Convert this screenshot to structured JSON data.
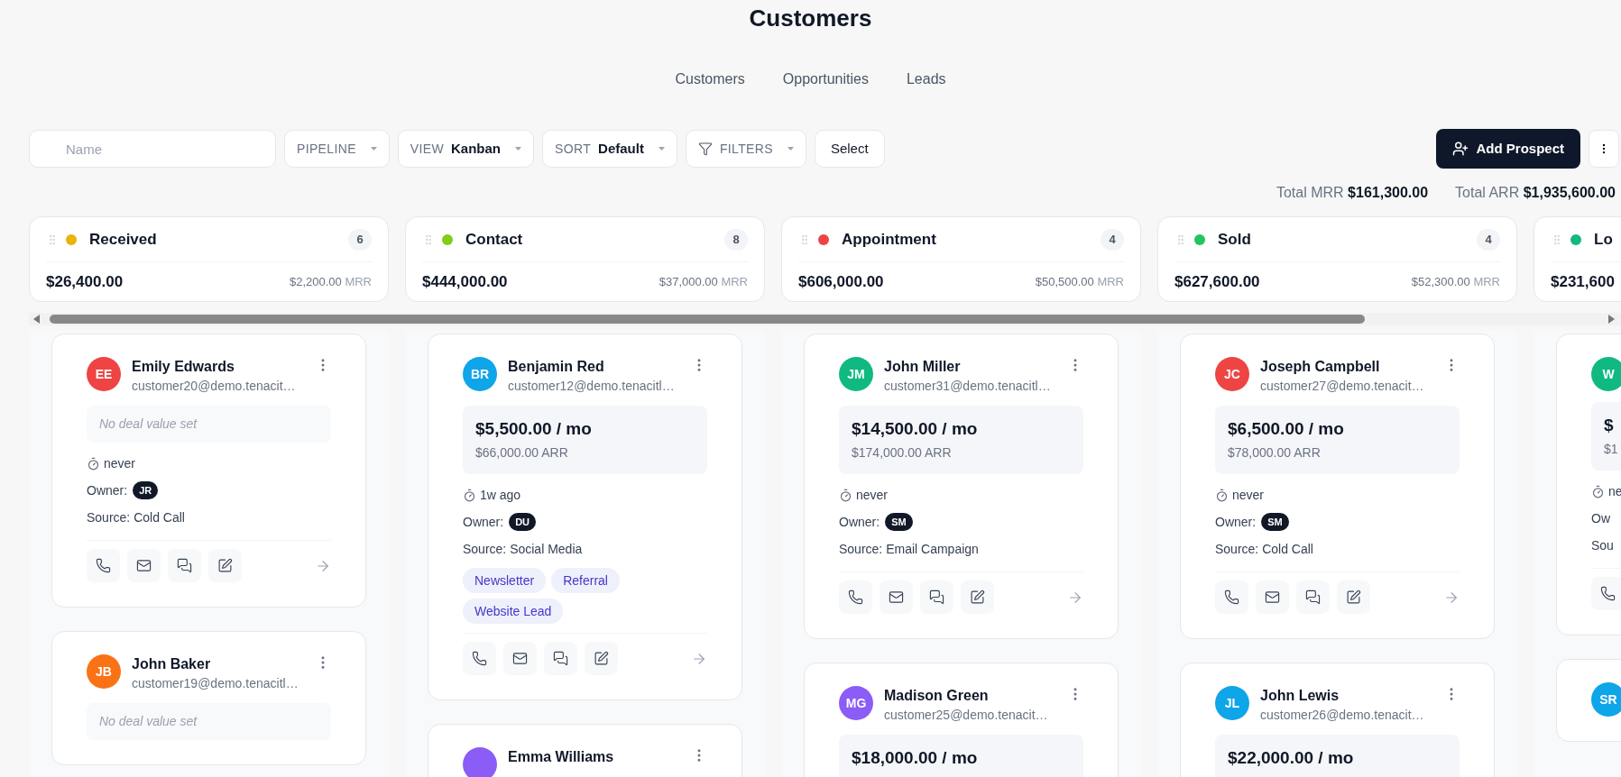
{
  "title": "Customers",
  "tabs": [
    {
      "label": "Customers",
      "selected": false
    },
    {
      "label": "Opportunities",
      "selected": false
    },
    {
      "label": "Leads",
      "selected": false
    }
  ],
  "toolbar": {
    "search": {
      "placeholder": "Name"
    },
    "dropdowns": [
      {
        "kind": "select",
        "label": "PIPELINE"
      },
      {
        "kind": "select",
        "label": "VIEW",
        "value": "Kanban"
      },
      {
        "kind": "select",
        "label": "SORT",
        "value": "Default"
      },
      {
        "kind": "filter",
        "label": "FILTERS"
      }
    ],
    "select_button": "Select",
    "add_button": "Add Prospect"
  },
  "totals": [
    {
      "label": "Total MRR",
      "value": "$161,300.00"
    },
    {
      "label": "Total ARR",
      "value": "$1,935,600.00"
    }
  ],
  "columns": [
    {
      "stage": {
        "name": "Received",
        "color": "#eab308",
        "count": "6",
        "total": "$26,400.00",
        "mrr": "$2,200.00",
        "mrr_unit": "MRR"
      },
      "cards": [
        {
          "initials": "EE",
          "color": "#ef4444",
          "name": "Emily Edwards",
          "email": "customer20@demo.tenacit…",
          "deal": {
            "kind": "empty",
            "text": "No deal value set"
          },
          "last_contact": "never",
          "owner_label": "Owner:",
          "owner": "JR",
          "source": "Source: Cold Call",
          "actions": true
        },
        {
          "initials": "JB",
          "color": "#f97316",
          "name": "John Baker",
          "email": "customer19@demo.tenacitl…",
          "deal": {
            "kind": "empty",
            "text": "No deal value set"
          }
        }
      ]
    },
    {
      "stage": {
        "name": "Contact",
        "color": "#84cc16",
        "count": "8",
        "total": "$444,000.00",
        "mrr": "$37,000.00",
        "mrr_unit": "MRR"
      },
      "cards": [
        {
          "initials": "BR",
          "color": "#0ea5e9",
          "name": "Benjamin Red",
          "email": "customer12@demo.tenacitl…",
          "deal": {
            "kind": "value",
            "mrr": "$5,500.00 / mo",
            "arr": "$66,000.00 ARR"
          },
          "last_contact": "1w ago",
          "owner_label": "Owner:",
          "owner": "DU",
          "source": "Source: Social Media",
          "tags": [
            "Newsletter",
            "Referral",
            "Website Lead"
          ],
          "actions": true
        },
        {
          "color": "#8b5cf6",
          "name": "Emma Williams"
        }
      ]
    },
    {
      "stage": {
        "name": "Appointment",
        "color": "#ef4444",
        "count": "4",
        "total": "$606,000.00",
        "mrr": "$50,500.00",
        "mrr_unit": "MRR"
      },
      "cards": [
        {
          "initials": "JM",
          "color": "#10b981",
          "name": "John Miller",
          "email": "customer31@demo.tenacitl…",
          "deal": {
            "kind": "value",
            "mrr": "$14,500.00 / mo",
            "arr": "$174,000.00 ARR"
          },
          "last_contact": "never",
          "owner_label": "Owner:",
          "owner": "SM",
          "source": "Source: Email Campaign",
          "actions": true
        },
        {
          "initials": "MG",
          "color": "#8b5cf6",
          "name": "Madison Green",
          "email": "customer25@demo.tenacit…",
          "deal": {
            "kind": "value",
            "mrr": "$18,000.00 / mo"
          }
        }
      ]
    },
    {
      "stage": {
        "name": "Sold",
        "color": "#22c55e",
        "count": "4",
        "total": "$627,600.00",
        "mrr": "$52,300.00",
        "mrr_unit": "MRR"
      },
      "cards": [
        {
          "initials": "JC",
          "color": "#ef4444",
          "name": "Joseph Campbell",
          "email": "customer27@demo.tenacit…",
          "deal": {
            "kind": "value",
            "mrr": "$6,500.00 / mo",
            "arr": "$78,000.00 ARR"
          },
          "last_contact": "never",
          "owner_label": "Owner:",
          "owner": "SM",
          "source": "Source: Cold Call",
          "actions": true
        },
        {
          "initials": "JL",
          "color": "#0ea5e9",
          "name": "John Lewis",
          "email": "customer26@demo.tenacit…",
          "deal": {
            "kind": "value",
            "mrr": "$22,000.00 / mo"
          }
        }
      ]
    },
    {
      "stage": {
        "name": "Lo",
        "color": "#10b981",
        "total": "$231,600"
      },
      "cards": [
        {
          "initials": "W",
          "color": "#10b981",
          "deal": {
            "kind": "value",
            "mrr": "$",
            "arr": "$1"
          },
          "last_contact": "ne",
          "owner_label": "Ow",
          "source": "Sou",
          "actions": true
        },
        {
          "initials": "SR",
          "color": "#0ea5e9"
        }
      ]
    }
  ]
}
